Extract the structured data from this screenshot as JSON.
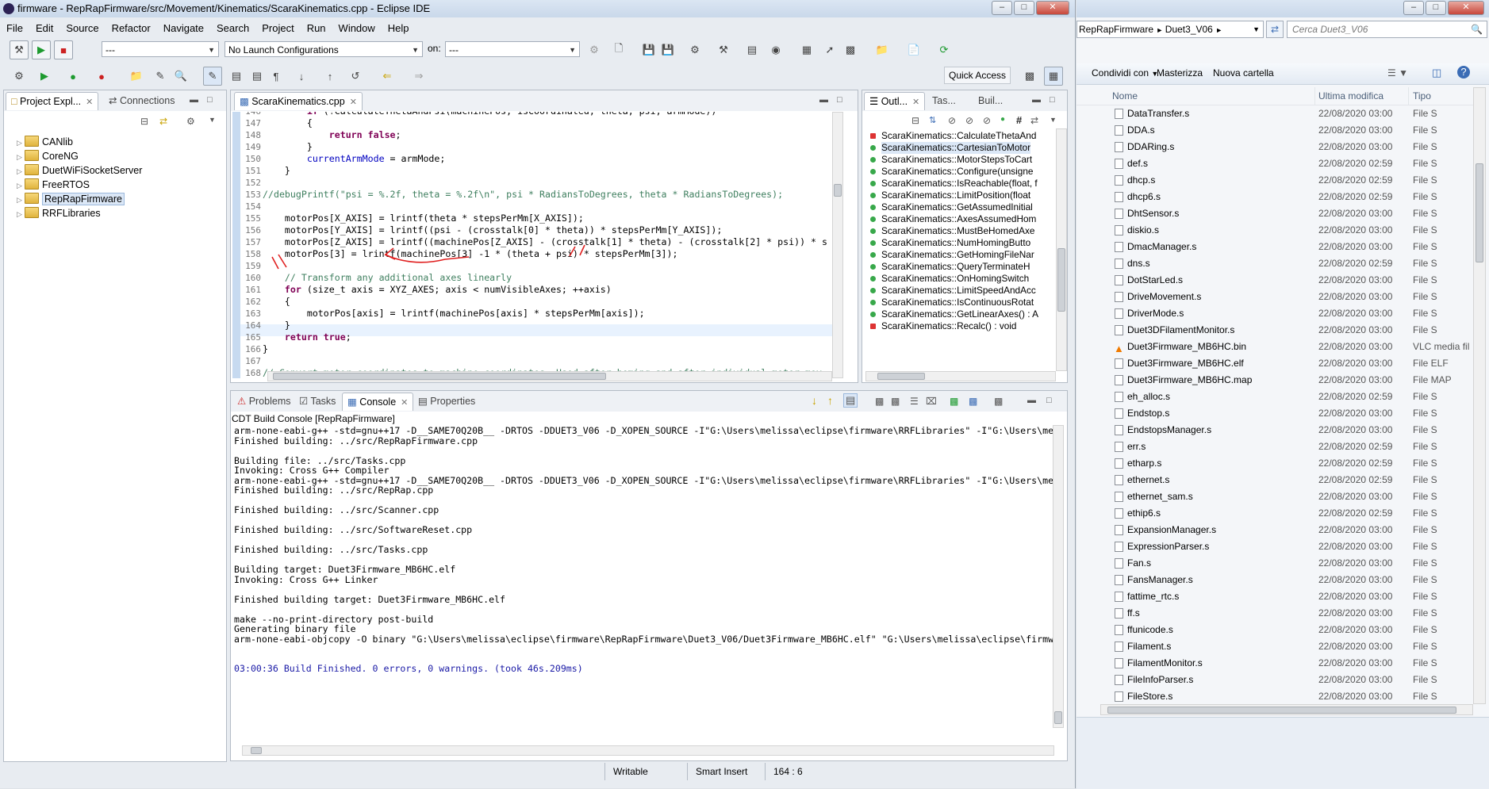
{
  "window": {
    "title": "firmware - RepRapFirmware/src/Movement/Kinematics/ScaraKinematics.cpp - Eclipse IDE"
  },
  "menu": [
    "File",
    "Edit",
    "Source",
    "Refactor",
    "Navigate",
    "Search",
    "Project",
    "Run",
    "Window",
    "Help"
  ],
  "toolbar": {
    "launch_mode": "---",
    "launch_config": "No Launch Configurations",
    "on_label": "on:",
    "launch_target": "---",
    "quick_access": "Quick Access"
  },
  "project_explorer": {
    "tab_label": "Project Expl...",
    "tab2_label": "Connections",
    "projects": [
      "CANlib",
      "CoreNG",
      "DuetWiFiSocketServer",
      "FreeRTOS",
      "RepRapFirmware",
      "RRFLibraries"
    ],
    "selected": "RepRapFirmware"
  },
  "editor": {
    "tab_label": "ScaraKinematics.cpp",
    "lines": [
      {
        "n": "146",
        "html": "        if (!CalculateThetaAndPsi(machinePos, isCoordinated, theta, psi, armMode))"
      },
      {
        "n": "147",
        "html": "        {"
      },
      {
        "n": "148",
        "html": "            return false;"
      },
      {
        "n": "149",
        "html": "        }"
      },
      {
        "n": "150",
        "html": "        currentArmMode = armMode;"
      },
      {
        "n": "151",
        "html": "    }"
      },
      {
        "n": "152",
        "html": ""
      },
      {
        "n": "153",
        "html": "//debugPrintf(\"psi = %.2f, theta = %.2f\\n\", psi * RadiansToDegrees, theta * RadiansToDegrees);"
      },
      {
        "n": "154",
        "html": ""
      },
      {
        "n": "155",
        "html": "    motorPos[X_AXIS] = lrintf(theta * stepsPerMm[X_AXIS]);"
      },
      {
        "n": "156",
        "html": "    motorPos[Y_AXIS] = lrintf((psi - (crosstalk[0] * theta)) * stepsPerMm[Y_AXIS]);"
      },
      {
        "n": "157",
        "html": "    motorPos[Z_AXIS] = lrintf((machinePos[Z_AXIS] - (crosstalk[1] * theta) - (crosstalk[2] * psi)) * s"
      },
      {
        "n": "158",
        "html": "    motorPos[3] = lrintf(machinePos[3] -1 * (theta + psi) * stepsPerMm[3]);"
      },
      {
        "n": "159",
        "html": ""
      },
      {
        "n": "160",
        "html": "    // Transform any additional axes linearly"
      },
      {
        "n": "161",
        "html": "    for (size_t axis = XYZ_AXES; axis < numVisibleAxes; ++axis)"
      },
      {
        "n": "162",
        "html": "    {"
      },
      {
        "n": "163",
        "html": "        motorPos[axis] = lrintf(machinePos[axis] * stepsPerMm[axis]);"
      },
      {
        "n": "164",
        "html": "    }"
      },
      {
        "n": "165",
        "html": "    return true;"
      },
      {
        "n": "166",
        "html": "}"
      },
      {
        "n": "167",
        "html": ""
      },
      {
        "n": "168",
        "html": "// Convert motor coordinates to machine coordinates. Used after homing and after individual motor mov"
      }
    ]
  },
  "outline": {
    "tab_label": "Outl...",
    "tab2_label": "Tas...",
    "tab3_label": "Buil...",
    "items": [
      "ScaraKinematics::CalculateThetaAnd",
      "ScaraKinematics::CartesianToMotor",
      "ScaraKinematics::MotorStepsToCart",
      "ScaraKinematics::Configure(unsigne",
      "ScaraKinematics::IsReachable(float, f",
      "ScaraKinematics::LimitPosition(float",
      "ScaraKinematics::GetAssumedInitial",
      "ScaraKinematics::AxesAssumedHom",
      "ScaraKinematics::MustBeHomedAxe",
      "ScaraKinematics::NumHomingButto",
      "ScaraKinematics::GetHomingFileNar",
      "ScaraKinematics::QueryTerminateH",
      "ScaraKinematics::OnHomingSwitch",
      "ScaraKinematics::LimitSpeedAndAcc",
      "ScaraKinematics::IsContinuousRotat",
      "ScaraKinematics::GetLinearAxes() : A",
      "ScaraKinematics::Recalc() : void"
    ]
  },
  "bottom_tabs": {
    "problems": "Problems",
    "tasks": "Tasks",
    "console": "Console",
    "properties": "Properties"
  },
  "console": {
    "header": "CDT Build Console [RepRapFirmware]",
    "lines": [
      "arm-none-eabi-g++ -std=gnu++17 -D__SAME70Q20B__ -DRTOS -DDUET3_V06 -D_XOPEN_SOURCE -I\"G:\\Users\\melissa\\eclipse\\firmware\\RRFLibraries\" -I\"G:\\Users\\me",
      "Finished building: ../src/RepRapFirmware.cpp",
      "",
      "Building file: ../src/Tasks.cpp",
      "Invoking: Cross G++ Compiler",
      "arm-none-eabi-g++ -std=gnu++17 -D__SAME70Q20B__ -DRTOS -DDUET3_V06 -D_XOPEN_SOURCE -I\"G:\\Users\\melissa\\eclipse\\firmware\\RRFLibraries\" -I\"G:\\Users\\me",
      "Finished building: ../src/RepRap.cpp",
      "",
      "Finished building: ../src/Scanner.cpp",
      "",
      "Finished building: ../src/SoftwareReset.cpp",
      "",
      "Finished building: ../src/Tasks.cpp",
      "",
      "Building target: Duet3Firmware_MB6HC.elf",
      "Invoking: Cross G++ Linker",
      "",
      "Finished building target: Duet3Firmware_MB6HC.elf",
      "",
      "make --no-print-directory post-build",
      "Generating binary file",
      "arm-none-eabi-objcopy -O binary \"G:\\Users\\melissa\\eclipse\\firmware\\RepRapFirmware\\Duet3_V06/Duet3Firmware_MB6HC.elf\" \"G:\\Users\\melissa\\eclipse\\firmw",
      "",
      "",
      "03:00:36 Build Finished. 0 errors, 0 warnings. (took 46s.209ms)"
    ]
  },
  "status": {
    "writable": "Writable",
    "insert_mode": "Smart Insert",
    "position": "164 : 6"
  },
  "explorer": {
    "breadcrumb": [
      "RepRapFirmware",
      "Duet3_V06"
    ],
    "search_placeholder": "Cerca Duet3_V06",
    "toolbar": {
      "share": "Condividi con",
      "burn": "Masterizza",
      "new_folder": "Nuova cartella"
    },
    "columns": {
      "name": "Nome",
      "modified": "Ultima modifica",
      "type": "Tipo"
    },
    "files": [
      {
        "name": "DataTransfer.s",
        "date": "22/08/2020 03:00",
        "type": "File S"
      },
      {
        "name": "DDA.s",
        "date": "22/08/2020 03:00",
        "type": "File S"
      },
      {
        "name": "DDARing.s",
        "date": "22/08/2020 03:00",
        "type": "File S"
      },
      {
        "name": "def.s",
        "date": "22/08/2020 02:59",
        "type": "File S"
      },
      {
        "name": "dhcp.s",
        "date": "22/08/2020 02:59",
        "type": "File S"
      },
      {
        "name": "dhcp6.s",
        "date": "22/08/2020 02:59",
        "type": "File S"
      },
      {
        "name": "DhtSensor.s",
        "date": "22/08/2020 03:00",
        "type": "File S"
      },
      {
        "name": "diskio.s",
        "date": "22/08/2020 03:00",
        "type": "File S"
      },
      {
        "name": "DmacManager.s",
        "date": "22/08/2020 03:00",
        "type": "File S"
      },
      {
        "name": "dns.s",
        "date": "22/08/2020 02:59",
        "type": "File S"
      },
      {
        "name": "DotStarLed.s",
        "date": "22/08/2020 03:00",
        "type": "File S"
      },
      {
        "name": "DriveMovement.s",
        "date": "22/08/2020 03:00",
        "type": "File S"
      },
      {
        "name": "DriverMode.s",
        "date": "22/08/2020 03:00",
        "type": "File S"
      },
      {
        "name": "Duet3DFilamentMonitor.s",
        "date": "22/08/2020 03:00",
        "type": "File S"
      },
      {
        "name": "Duet3Firmware_MB6HC.bin",
        "date": "22/08/2020 03:00",
        "type": "VLC media fil"
      },
      {
        "name": "Duet3Firmware_MB6HC.elf",
        "date": "22/08/2020 03:00",
        "type": "File ELF"
      },
      {
        "name": "Duet3Firmware_MB6HC.map",
        "date": "22/08/2020 03:00",
        "type": "File MAP"
      },
      {
        "name": "eh_alloc.s",
        "date": "22/08/2020 02:59",
        "type": "File S"
      },
      {
        "name": "Endstop.s",
        "date": "22/08/2020 03:00",
        "type": "File S"
      },
      {
        "name": "EndstopsManager.s",
        "date": "22/08/2020 03:00",
        "type": "File S"
      },
      {
        "name": "err.s",
        "date": "22/08/2020 02:59",
        "type": "File S"
      },
      {
        "name": "etharp.s",
        "date": "22/08/2020 02:59",
        "type": "File S"
      },
      {
        "name": "ethernet.s",
        "date": "22/08/2020 02:59",
        "type": "File S"
      },
      {
        "name": "ethernet_sam.s",
        "date": "22/08/2020 03:00",
        "type": "File S"
      },
      {
        "name": "ethip6.s",
        "date": "22/08/2020 02:59",
        "type": "File S"
      },
      {
        "name": "ExpansionManager.s",
        "date": "22/08/2020 03:00",
        "type": "File S"
      },
      {
        "name": "ExpressionParser.s",
        "date": "22/08/2020 03:00",
        "type": "File S"
      },
      {
        "name": "Fan.s",
        "date": "22/08/2020 03:00",
        "type": "File S"
      },
      {
        "name": "FansManager.s",
        "date": "22/08/2020 03:00",
        "type": "File S"
      },
      {
        "name": "fattime_rtc.s",
        "date": "22/08/2020 03:00",
        "type": "File S"
      },
      {
        "name": "ff.s",
        "date": "22/08/2020 03:00",
        "type": "File S"
      },
      {
        "name": "ffunicode.s",
        "date": "22/08/2020 03:00",
        "type": "File S"
      },
      {
        "name": "Filament.s",
        "date": "22/08/2020 03:00",
        "type": "File S"
      },
      {
        "name": "FilamentMonitor.s",
        "date": "22/08/2020 03:00",
        "type": "File S"
      },
      {
        "name": "FileInfoParser.s",
        "date": "22/08/2020 03:00",
        "type": "File S"
      },
      {
        "name": "FileStore.s",
        "date": "22/08/2020 03:00",
        "type": "File S"
      }
    ]
  },
  "colors": {
    "keyword": "#7f0055",
    "comment": "#3f7f5f",
    "string": "#2a00ff",
    "annotation_red": "#e02020",
    "build_finished": "#1a1aa6"
  }
}
